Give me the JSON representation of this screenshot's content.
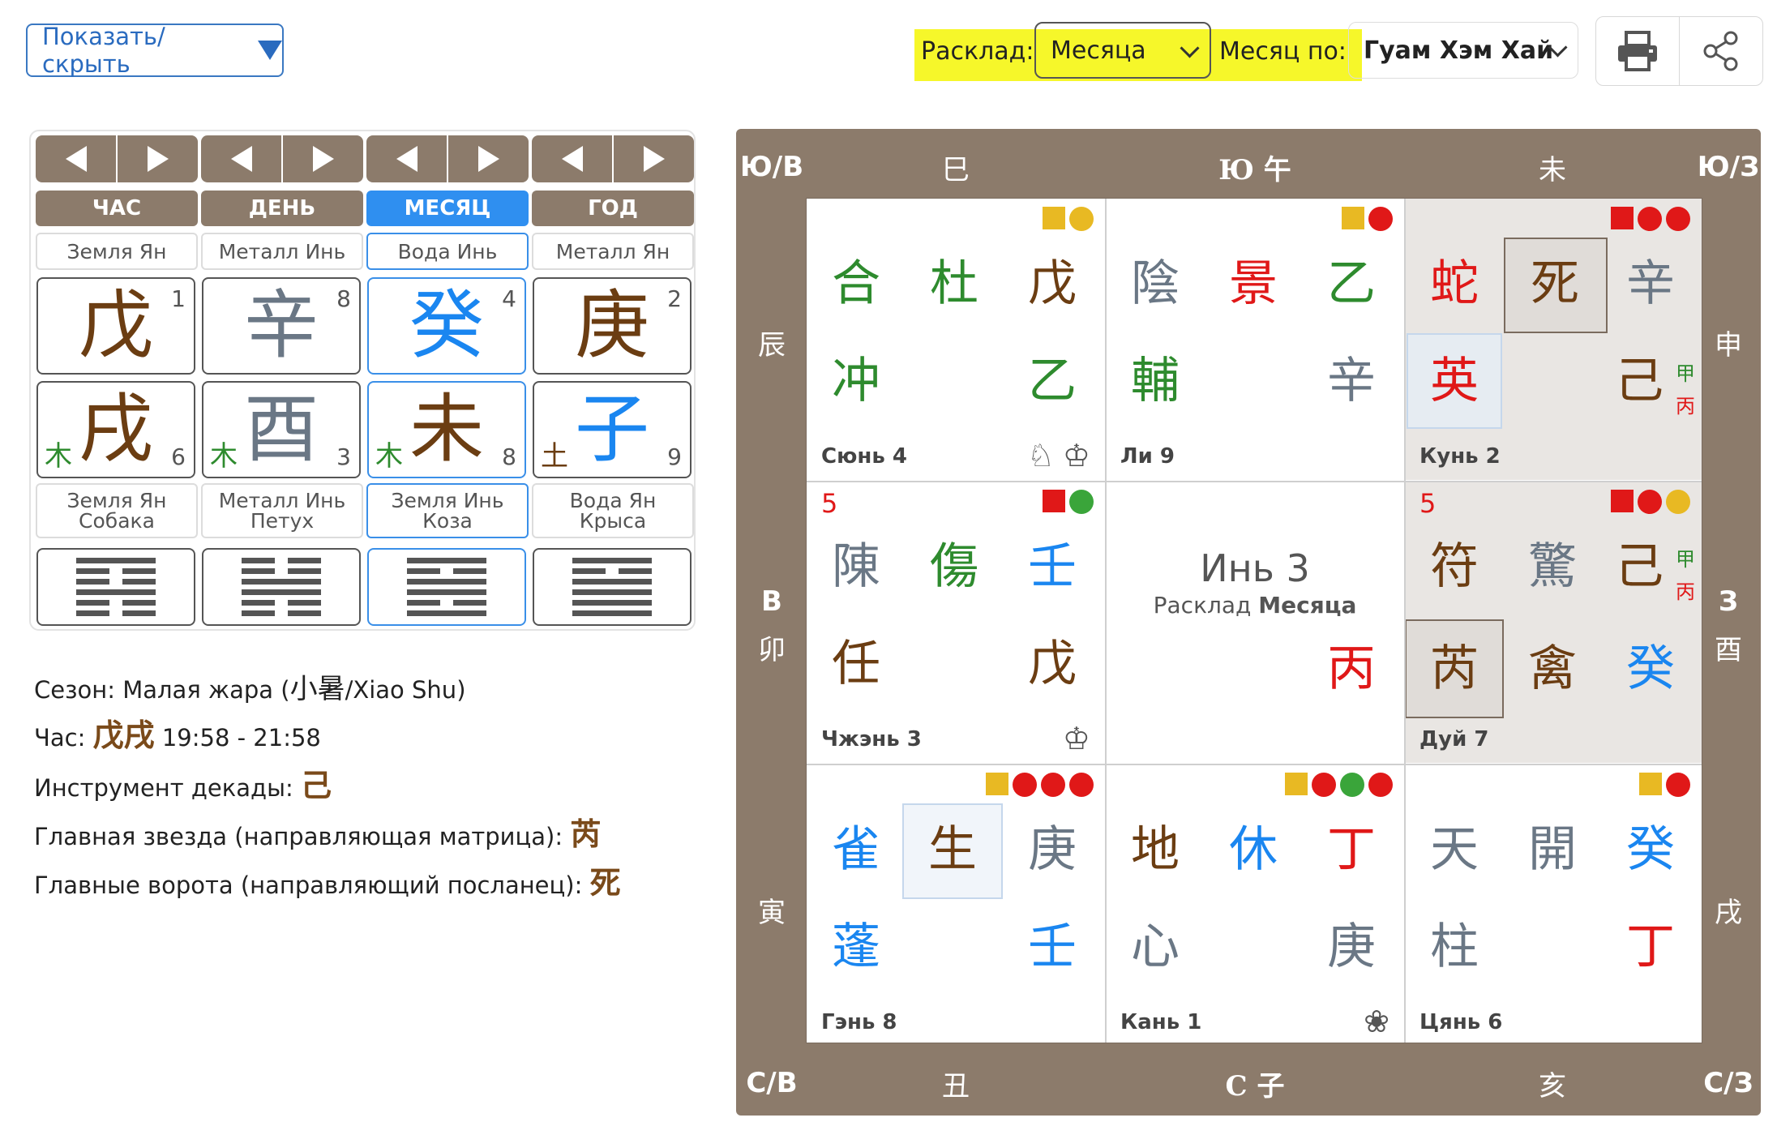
{
  "topbar": {
    "show_hide": "Показать/скрыть",
    "layout_label": "Расклад:",
    "layout_value": "Месяца",
    "month_by_label": "Месяц по:",
    "month_by_value": "Гуам Хэм Хай",
    "print_icon": "printer-icon",
    "share_icon": "share-icon"
  },
  "pillars": {
    "tabs": [
      "ЧАС",
      "ДЕНЬ",
      "МЕСЯЦ",
      "ГОД"
    ],
    "active_tab": "МЕСЯЦ",
    "stem_elements": [
      "Земля Ян",
      "Металл Инь",
      "Вода Инь",
      "Металл Ян"
    ],
    "stems": [
      {
        "char": "戊",
        "num": "1",
        "color": "#6b3d12"
      },
      {
        "char": "辛",
        "num": "8",
        "color": "#6a7785"
      },
      {
        "char": "癸",
        "num": "4",
        "color": "#1a86f0"
      },
      {
        "char": "庚",
        "num": "2",
        "color": "#6b3d12"
      }
    ],
    "branches": [
      {
        "char": "戌",
        "num": "6",
        "small": "木",
        "small_color": "#2e8b2e",
        "color": "#6b3d12"
      },
      {
        "char": "酉",
        "num": "3",
        "small": "木",
        "small_color": "#2e8b2e",
        "color": "#6a7785"
      },
      {
        "char": "未",
        "num": "8",
        "small": "木",
        "small_color": "#2e8b2e",
        "color": "#6b3d12"
      },
      {
        "char": "子",
        "num": "9",
        "small": "土",
        "small_color": "#6b3d12",
        "color": "#1a86f0"
      }
    ],
    "animals": [
      [
        "Земля Ян",
        "Собака"
      ],
      [
        "Металл Инь",
        "Петух"
      ],
      [
        "Земля Инь",
        "Коза"
      ],
      [
        "Вода Ян",
        "Крыса"
      ]
    ]
  },
  "info": {
    "season_label": "Сезон:",
    "season_value_pre": "Малая жара (",
    "season_cn": "小暑",
    "season_value_post": "/Xiao Shu)",
    "hour_label": "Час:",
    "hour_chars": "戊戌",
    "hour_time": "19:58 - 21:58",
    "decade_label": "Инструмент декады:",
    "decade_char": "己",
    "star_label": "Главная звезда (направляющая матрица):",
    "star_char": "芮",
    "gate_label": "Главные ворота (направляющий посланец):",
    "gate_char": "死"
  },
  "board": {
    "corners": [
      "Ю/В",
      "Ю/З",
      "С/В",
      "С/З"
    ],
    "top": [
      "巳",
      "Ю 午",
      "未"
    ],
    "bottom": [
      "丑",
      "С 子",
      "亥"
    ],
    "left": [
      "辰",
      "В",
      "卯",
      "寅"
    ],
    "right": [
      "申",
      "З",
      "酉",
      "戌"
    ],
    "center_title": "Инь 3",
    "center_sub_pre": "Расклад ",
    "center_sub_bold": "Месяца",
    "center_char": "丙",
    "palaces": {
      "xun": {
        "name": "Сюнь 4",
        "r1": [
          "合",
          "杜",
          "戊"
        ],
        "r2": [
          "冲",
          "",
          "乙"
        ]
      },
      "li": {
        "name": "Ли 9",
        "r1": [
          "陰",
          "景",
          "乙"
        ],
        "r2": [
          "輔",
          "",
          "辛"
        ]
      },
      "kun": {
        "name": "Кунь 2",
        "r1": [
          "蛇",
          "死",
          "辛"
        ],
        "r2": [
          "英",
          "",
          "己"
        ],
        "sub": [
          "甲",
          "丙"
        ]
      },
      "zhen": {
        "name": "Чжэнь 3",
        "badge": "5",
        "r1": [
          "陳",
          "傷",
          "壬"
        ],
        "r2": [
          "任",
          "",
          "戊"
        ]
      },
      "dui": {
        "name": "Дуй 7",
        "badge": "5",
        "r1": [
          "符",
          "驚",
          "己"
        ],
        "r2": [
          "芮",
          "禽",
          "癸"
        ],
        "sub": [
          "甲",
          "丙"
        ]
      },
      "gen": {
        "name": "Гэнь 8",
        "r1": [
          "雀",
          "生",
          "庚"
        ],
        "r2": [
          "蓬",
          "",
          "壬"
        ]
      },
      "kan": {
        "name": "Кань 1",
        "r1": [
          "地",
          "休",
          "丁"
        ],
        "r2": [
          "心",
          "",
          "庚"
        ]
      },
      "qian": {
        "name": "Цянь 6",
        "r1": [
          "天",
          "開",
          "癸"
        ],
        "r2": [
          "柱",
          "",
          "丁"
        ]
      }
    }
  },
  "colors": {
    "board": "#8c7b6b",
    "active_blue": "#2f8ff0",
    "highlight": "#f6f72a",
    "brown": "#6b3d12",
    "green": "#2e8b2e",
    "red": "#e01818",
    "blue": "#1a86f0",
    "gray": "#6a7785"
  }
}
